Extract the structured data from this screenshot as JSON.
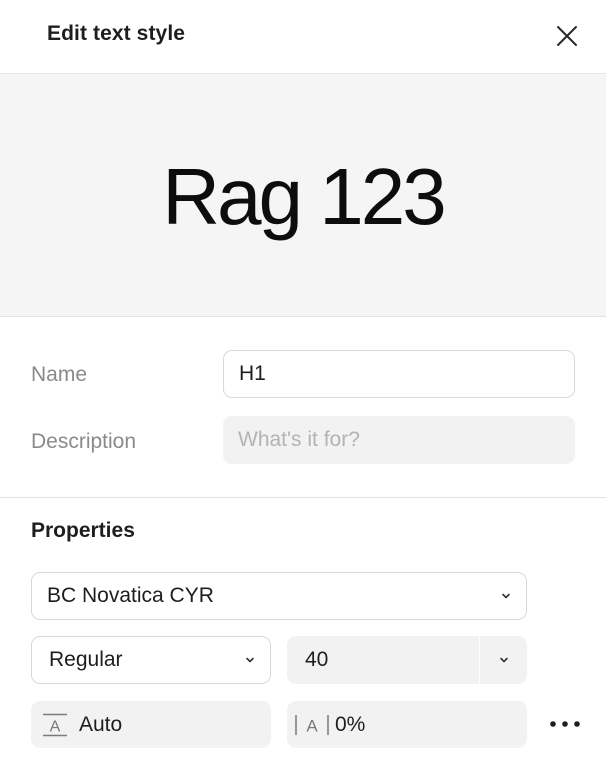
{
  "header": {
    "title": "Edit text style",
    "close_icon": "close-icon"
  },
  "preview": {
    "sample_text": "Rag 123"
  },
  "form": {
    "name_label": "Name",
    "name_value": "H1",
    "description_label": "Description",
    "description_placeholder": "What's it for?"
  },
  "properties": {
    "title": "Properties",
    "font_family": "BC Novatica CYR",
    "font_weight": "Regular",
    "font_size": "40",
    "line_height": "Auto",
    "letter_spacing": "0%",
    "icons": {
      "chevron": "chevron-down-icon",
      "line_height": "line-height-icon",
      "letter_spacing": "letter-spacing-icon",
      "more": "more-options-icon"
    }
  },
  "colors": {
    "accent_text": "#1e1e1e",
    "muted_label": "#8a8a8a",
    "placeholder": "#b3b3b3",
    "preview_bg": "#f5f5f5",
    "field_bg": "#f2f2f2",
    "border": "#d9d9d9"
  }
}
